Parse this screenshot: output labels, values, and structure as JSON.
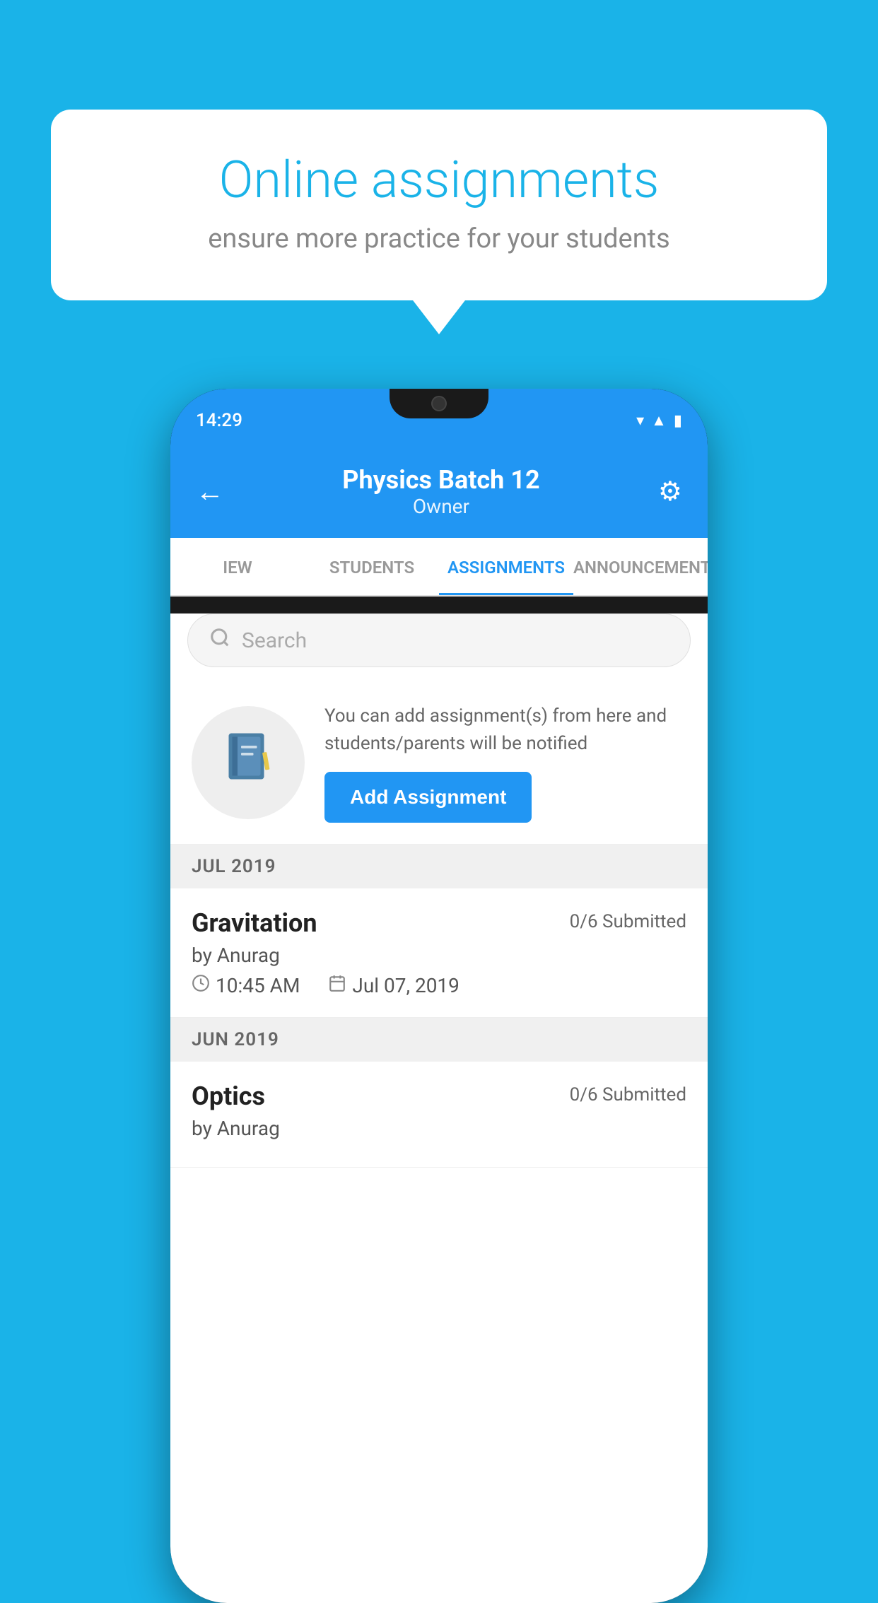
{
  "background_color": "#1ab3e8",
  "speech_bubble": {
    "title": "Online assignments",
    "subtitle": "ensure more practice for your students"
  },
  "phone": {
    "status_bar": {
      "time": "14:29",
      "icons": [
        "wifi",
        "signal",
        "battery"
      ]
    },
    "header": {
      "title": "Physics Batch 12",
      "subtitle": "Owner",
      "back_label": "←",
      "settings_label": "⚙"
    },
    "tabs": [
      {
        "label": "IEW",
        "active": false
      },
      {
        "label": "STUDENTS",
        "active": false
      },
      {
        "label": "ASSIGNMENTS",
        "active": true
      },
      {
        "label": "ANNOUNCEMENTS",
        "active": false
      }
    ],
    "search": {
      "placeholder": "Search"
    },
    "promo": {
      "text": "You can add assignment(s) from here and students/parents will be notified",
      "button_label": "Add Assignment"
    },
    "sections": [
      {
        "label": "JUL 2019",
        "assignments": [
          {
            "name": "Gravitation",
            "submitted": "0/6 Submitted",
            "author": "by Anurag",
            "time": "10:45 AM",
            "date": "Jul 07, 2019"
          }
        ]
      },
      {
        "label": "JUN 2019",
        "assignments": [
          {
            "name": "Optics",
            "submitted": "0/6 Submitted",
            "author": "by Anurag",
            "time": "",
            "date": ""
          }
        ]
      }
    ]
  }
}
